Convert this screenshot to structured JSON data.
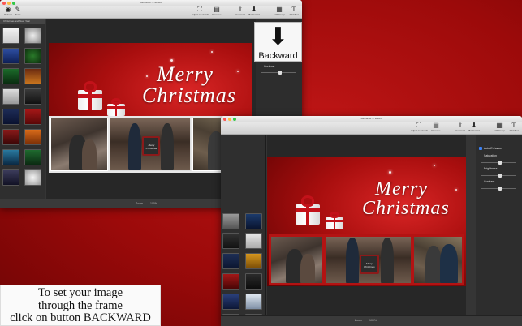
{
  "window1": {
    "title": "sachache — Edited",
    "toolbar_left": [
      {
        "label": "Options",
        "icon": "options-icon"
      },
      {
        "label": "Tools",
        "icon": "tools-icon"
      }
    ],
    "toolbar_right": [
      {
        "label": "Adjust to sketch",
        "icon": "adjust-icon"
      },
      {
        "label": "Remove",
        "icon": "remove-icon"
      },
      {
        "label": "Forward",
        "icon": "forward-icon"
      },
      {
        "label": "Backward",
        "icon": "backward-icon"
      },
      {
        "label": "Add Image",
        "icon": "add-image-icon"
      },
      {
        "label": "Add Text",
        "icon": "add-text-icon"
      }
    ],
    "sidebar_header": "Christmas and New Year",
    "right_panel": {
      "contrast_label": "Contrast"
    },
    "bottom": {
      "zoom_label": "Zoom",
      "zoom_value": "100%"
    }
  },
  "backward_callout": {
    "label": "Backward"
  },
  "window2": {
    "title": "sachache — Edited",
    "toolbar_right": [
      {
        "label": "Adjust to sketch",
        "icon": "adjust-icon"
      },
      {
        "label": "Remove",
        "icon": "remove-icon"
      },
      {
        "label": "Forward",
        "icon": "forward-icon"
      },
      {
        "label": "Backward",
        "icon": "backward-icon"
      },
      {
        "label": "Add Image",
        "icon": "add-image-icon"
      },
      {
        "label": "Add Text",
        "icon": "add-text-icon"
      }
    ],
    "right_panel": {
      "auto_enhance": "Auto-Enhance",
      "saturation": "Saturation",
      "brightness": "Brightness",
      "contrast": "Contrast"
    },
    "bottom": {
      "zoom_label": "Zoom",
      "zoom_value": "100%"
    }
  },
  "card": {
    "line1": "Merry",
    "line2": "Christmas",
    "chalkboard": "Merry Christmas"
  },
  "caption": {
    "line1": "To set your image",
    "line2": "through the frame",
    "line3": "click on button BACKWARD"
  },
  "colors": {
    "accent_red": "#c3121a",
    "background": "#b00e0e"
  }
}
